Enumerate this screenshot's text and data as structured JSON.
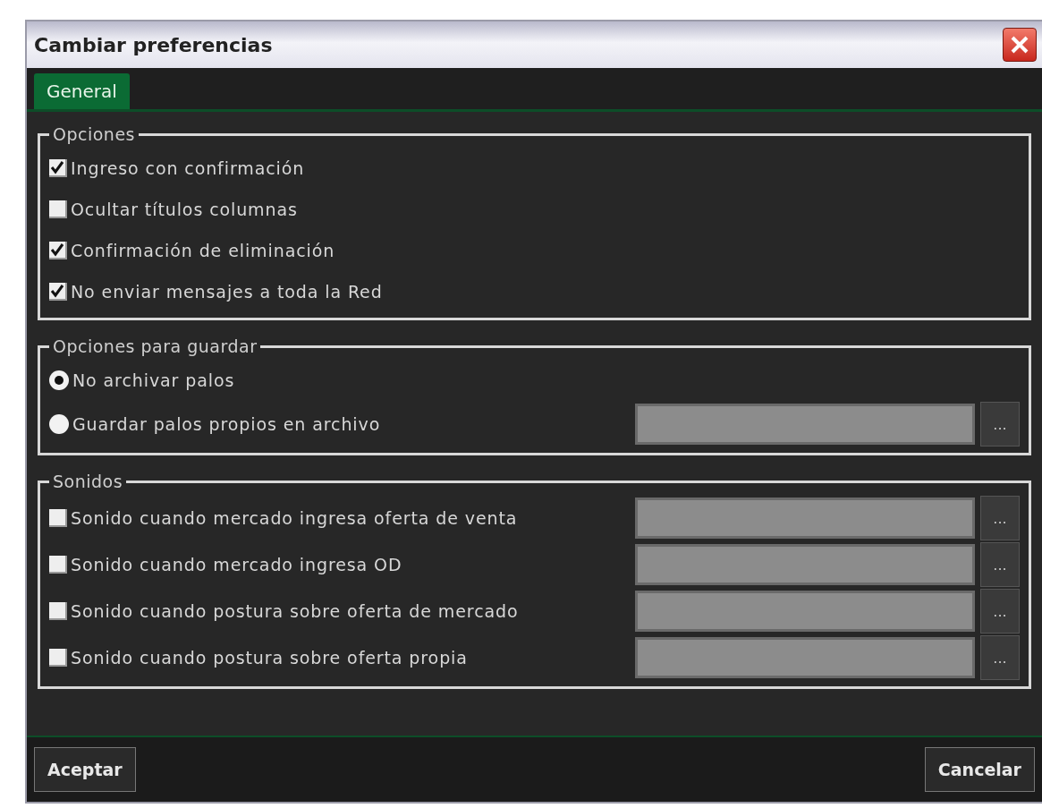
{
  "window": {
    "title": "Cambiar preferencias"
  },
  "tabs": [
    {
      "label": "General",
      "selected": true
    }
  ],
  "groups": [
    {
      "title": "Opciones",
      "items": [
        {
          "kind": "checkbox",
          "label": "Ingreso con confirmación",
          "checked": true
        },
        {
          "kind": "checkbox",
          "label": "Ocultar títulos columnas",
          "checked": false
        },
        {
          "kind": "checkbox",
          "label": "Confirmación de eliminación",
          "checked": true
        },
        {
          "kind": "checkbox",
          "label": "No enviar mensajes a toda la Red",
          "checked": true
        }
      ]
    },
    {
      "title": "Opciones para guardar",
      "items": [
        {
          "kind": "radio",
          "label": "No archivar palos",
          "selected": true
        },
        {
          "kind": "radio",
          "label": "Guardar palos propios en archivo",
          "selected": false,
          "browse": "..."
        }
      ]
    },
    {
      "title": "Sonidos",
      "items": [
        {
          "kind": "checkbox",
          "label": "Sonido cuando mercado ingresa oferta de venta",
          "checked": false,
          "browse": "..."
        },
        {
          "kind": "checkbox",
          "label": "Sonido cuando mercado ingresa OD",
          "checked": false,
          "browse": "..."
        },
        {
          "kind": "checkbox",
          "label": "Sonido cuando postura sobre oferta de mercado",
          "checked": false,
          "browse": "..."
        },
        {
          "kind": "checkbox",
          "label": "Sonido cuando postura sobre oferta propia",
          "checked": false,
          "browse": "..."
        }
      ]
    }
  ],
  "buttons": [
    "Aceptar",
    "Cancelar"
  ]
}
